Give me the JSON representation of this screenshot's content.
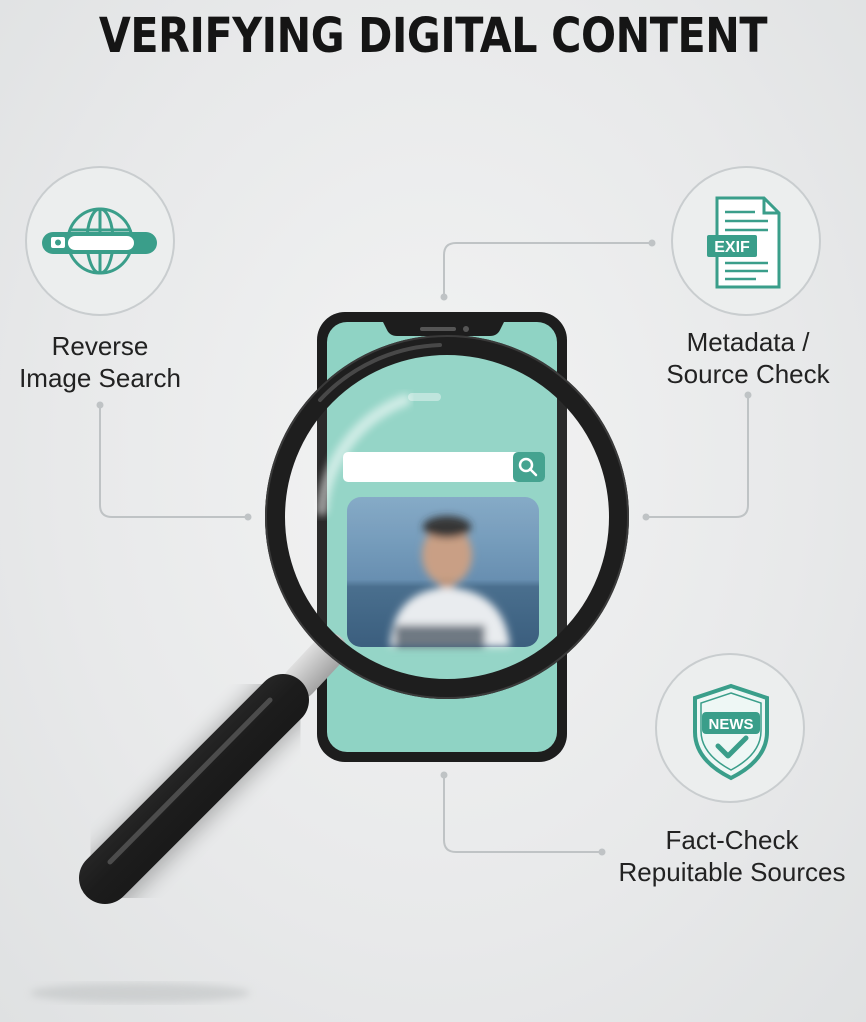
{
  "title": "VERIFYING DIGITAL CONTENT",
  "steps": [
    {
      "icon": "globe-camera-search-icon",
      "lines": [
        "Reverse",
        "Image Search"
      ]
    },
    {
      "icon": "exif-document-icon",
      "badge": "EXIF",
      "lines": [
        "Metadata /",
        "Source Check"
      ]
    },
    {
      "icon": "news-shield-check-icon",
      "badge": "NEWS",
      "lines": [
        "Fact-Check",
        "Repuitable Sources"
      ]
    }
  ],
  "colors": {
    "accent": "#3a9e8a",
    "phone_screen": "#8fd3c4",
    "magnifier": "#1e1e1e",
    "connector": "#bfc3c5"
  }
}
